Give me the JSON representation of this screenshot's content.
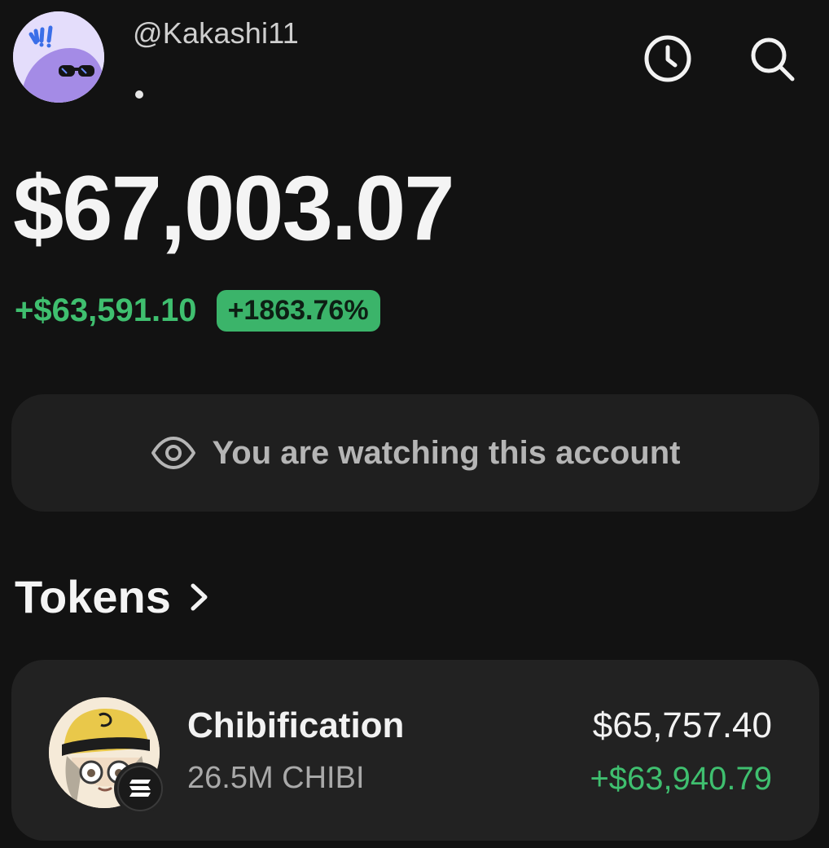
{
  "header": {
    "username": "@Kakashi11",
    "status_indicator": "·",
    "history_icon": "clock-icon",
    "search_icon": "search-icon",
    "avatar_icon": "sunglasses-avatar-icon"
  },
  "portfolio": {
    "balance": "$67,003.07",
    "change_amount": "+$63,591.10",
    "change_percent": "+1863.76%"
  },
  "watch_banner": {
    "icon": "eye-icon",
    "text": "You are watching this account"
  },
  "tokens": {
    "heading": "Tokens",
    "chevron_icon": "chevron-right-icon",
    "items": [
      {
        "name": "Chibification",
        "amount": "26.5M CHIBI",
        "value": "$65,757.40",
        "change": "+$63,940.79",
        "logo_icon": "chibi-token-logo",
        "chain_icon": "solana-icon"
      }
    ]
  },
  "colors": {
    "background": "#121212",
    "card": "#1f1f1f",
    "positive": "#3fbf6f",
    "badge": "#3bb46a"
  }
}
